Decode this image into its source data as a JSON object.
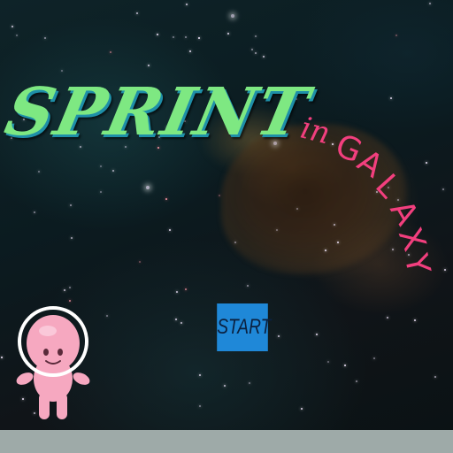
{
  "game": {
    "title_main": "SPRINT",
    "title_sub_in": "in",
    "title_sub_galaxy": [
      "G",
      "A",
      "L",
      "A",
      "X",
      "Y"
    ],
    "start_label": "START"
  },
  "colors": {
    "title_main": "#7ee882",
    "title_shadow": "#1e8fa8",
    "title_sub": "#f23f7e",
    "start_button": "#1f88d8",
    "start_text": "#0b2140",
    "alien_body": "#f6a8c0",
    "helmet_ring": "#ffffff",
    "ground": "#9eaaa8"
  },
  "icons": {
    "player": "pink-alien-astronaut-icon"
  }
}
